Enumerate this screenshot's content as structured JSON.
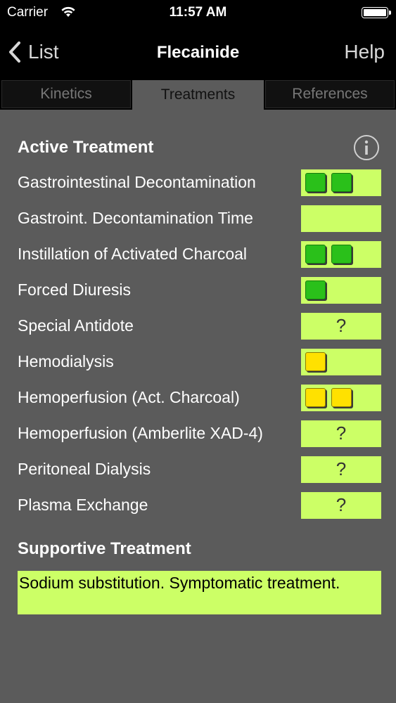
{
  "status_bar": {
    "carrier": "Carrier",
    "time": "11:57 AM"
  },
  "nav": {
    "back_label": "List",
    "title": "Flecainide",
    "help_label": "Help"
  },
  "tabs": [
    {
      "label": "Kinetics",
      "active": false
    },
    {
      "label": "Treatments",
      "active": true
    },
    {
      "label": "References",
      "active": false
    }
  ],
  "active_treatment": {
    "title": "Active Treatment",
    "rows": [
      {
        "label": "Gastrointestinal Decontamination",
        "indicator": "green",
        "count": 2
      },
      {
        "label": "Gastroint. Decontamination Time",
        "indicator": "none",
        "count": 0
      },
      {
        "label": "Instillation of Activated Charcoal",
        "indicator": "green",
        "count": 2
      },
      {
        "label": "Forced Diuresis",
        "indicator": "green",
        "count": 1
      },
      {
        "label": "Special Antidote",
        "indicator": "unknown",
        "text": "?"
      },
      {
        "label": "Hemodialysis",
        "indicator": "yellow",
        "count": 1
      },
      {
        "label": "Hemoperfusion (Act. Charcoal)",
        "indicator": "yellow",
        "count": 2
      },
      {
        "label": "Hemoperfusion (Amberlite XAD-4)",
        "indicator": "unknown",
        "text": "?"
      },
      {
        "label": "Peritoneal Dialysis",
        "indicator": "unknown",
        "text": "?"
      },
      {
        "label": "Plasma Exchange",
        "indicator": "unknown",
        "text": "?"
      }
    ]
  },
  "supportive_treatment": {
    "title": "Supportive Treatment",
    "text": "Sodium substitution. Symptomatic treatment."
  },
  "colors": {
    "background": "#5b5b5b",
    "indicator_bg": "#ccff66",
    "green": "#2ac01a",
    "yellow": "#ffe100"
  },
  "icons": {
    "back": "chevron-left-icon",
    "info": "info-icon",
    "wifi": "wifi-icon",
    "battery": "battery-icon"
  }
}
